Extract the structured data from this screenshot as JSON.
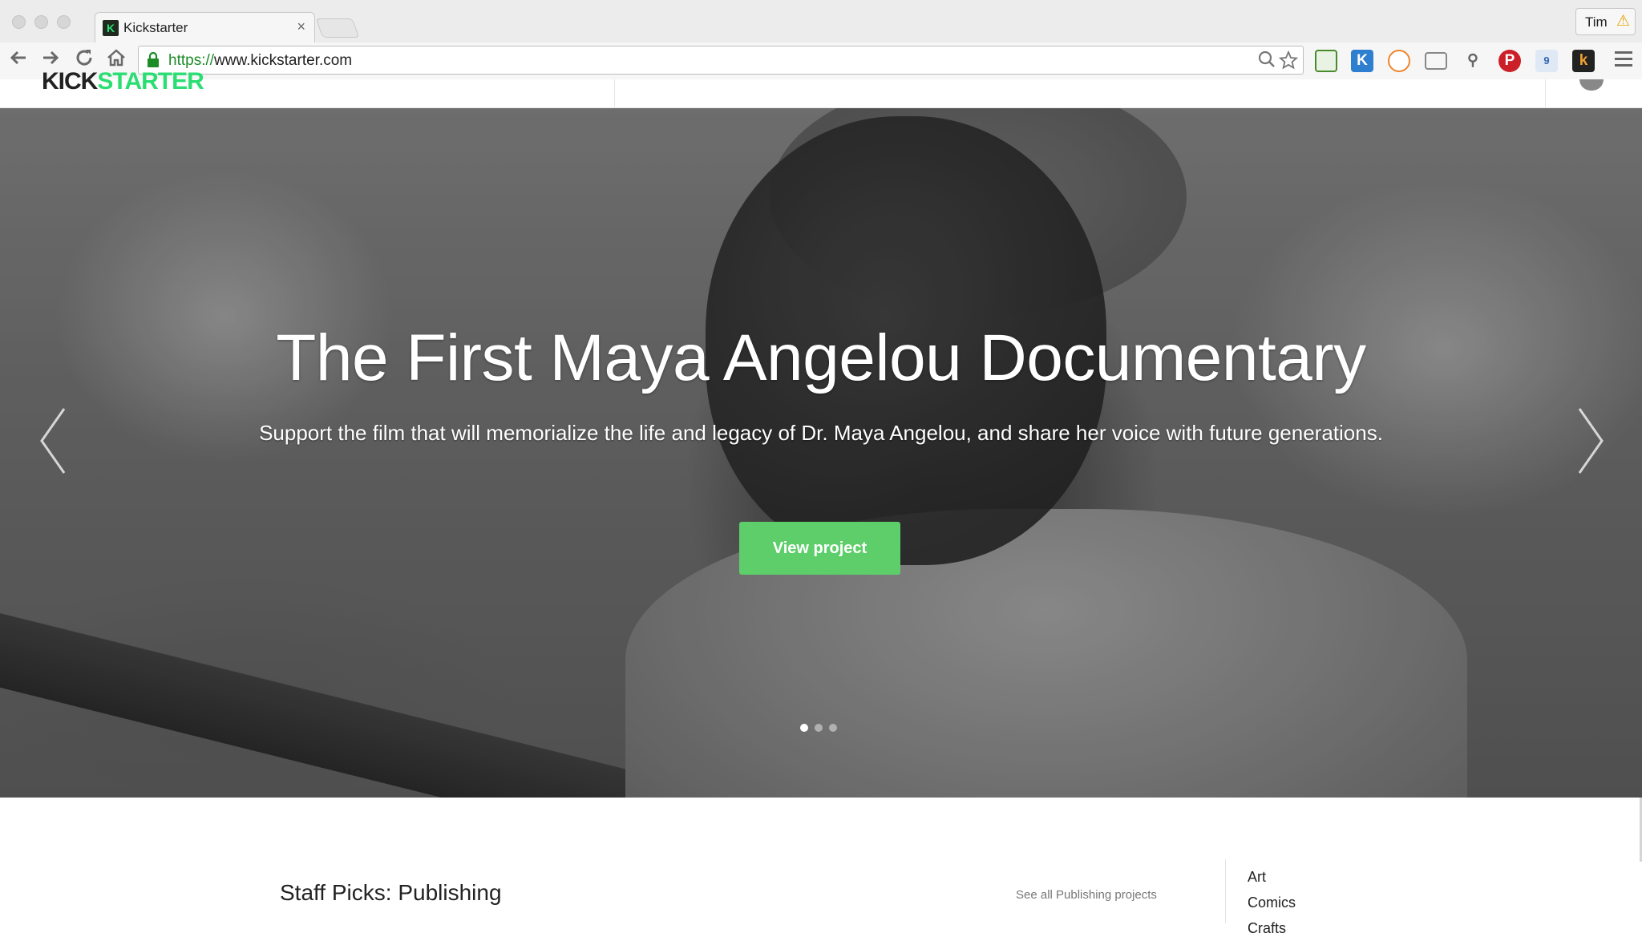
{
  "browser": {
    "tab_title": "Kickstarter",
    "tab_close": "×",
    "favicon_letter": "K",
    "profile_name": "Tim",
    "profile_warning": "⚠",
    "url_scheme": "https://",
    "url_host": "www.kickstarter.com",
    "ext_k_letter": "K",
    "ext_k2_letter": "k",
    "ext_badge": "9",
    "icons": [
      "back-icon",
      "forward-icon",
      "reload-icon",
      "home-icon",
      "lock-icon",
      "zoom-icon",
      "star-icon",
      "extension-icons",
      "menu-icon"
    ]
  },
  "site": {
    "logo_black": "KICK",
    "logo_green": "STARTER"
  },
  "hero": {
    "title": "The First Maya Angelou Documentary",
    "subtitle": "Support the film that will memorialize the life and legacy of Dr. Maya Angelou, and share her voice with future generations.",
    "button_label": "View project",
    "slide_count": 3,
    "active_slide": 1,
    "accent_color": "#5dce6a"
  },
  "staff_picks": {
    "title": "Staff Picks: Publishing",
    "link": "See all Publishing projects"
  },
  "categories": [
    "Art",
    "Comics",
    "Crafts"
  ]
}
